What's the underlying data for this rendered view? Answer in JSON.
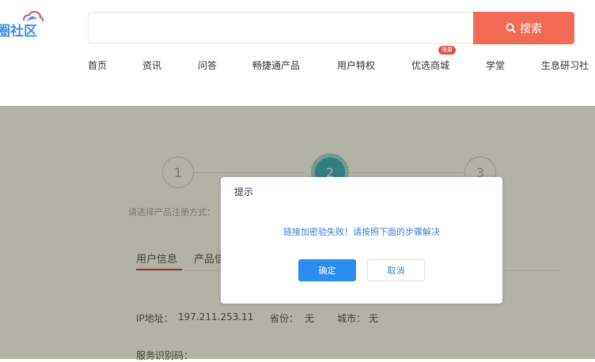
{
  "header": {
    "logo_text_main": "圈社区",
    "search": {
      "placeholder": "",
      "button_label": "搜索"
    },
    "nav": [
      "首页",
      "资讯",
      "问答",
      "畅捷通产品",
      "用户特权",
      "优选商城",
      "学堂",
      "生息研习社"
    ],
    "nav_badge": "限量"
  },
  "steps": {
    "items": [
      "1",
      "2",
      "3"
    ],
    "active": 2,
    "label": "请选择产品注册方式："
  },
  "tabs": {
    "items": [
      "用户信息",
      "产品信"
    ],
    "active": 0
  },
  "info": {
    "ip_label": "IP地址：",
    "ip_value": "197.211.253.11",
    "province_label": "省份：",
    "province_value": "无",
    "city_label": "城市：",
    "city_value": "无",
    "service_code_label": "服务识别码："
  },
  "dialog": {
    "title": "提示",
    "message": "链接加密验失败！请按照下面的步骤解决",
    "ok_label": "确定",
    "cancel_label": "取消"
  },
  "colors": {
    "brand_blue": "#3f8fe0",
    "search_button": "#f26a53",
    "primary_button": "#2d8cf0",
    "tab_underline": "#c0262d"
  }
}
